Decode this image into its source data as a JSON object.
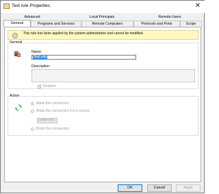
{
  "window": {
    "title": "Test rule Properties"
  },
  "tabs_back": [
    "Advanced",
    "Local Principals",
    "Remote Users"
  ],
  "tabs_front": [
    "General",
    "Programs and Services",
    "Remote Computers",
    "Protocols and Ports",
    "Scope"
  ],
  "info": {
    "text": "This rule has been applied by the system administrator and cannot be modified."
  },
  "general": {
    "group_label": "General",
    "name_label": "Name:",
    "name_value": "Test rule",
    "description_label": "Description:",
    "description_value": "",
    "enabled_label": "Enabled"
  },
  "action": {
    "group_label": "Action",
    "allow": "Allow the connection",
    "allow_secure": "Allow the connection if it is secure",
    "customize": "Customize...",
    "block": "Block the connection"
  },
  "buttons": {
    "ok": "OK",
    "cancel": "Cancel",
    "apply": "Apply"
  },
  "colors": {
    "accent": "#0078d7",
    "info_bg": "#fff9c4",
    "selection": "#3399ff"
  }
}
